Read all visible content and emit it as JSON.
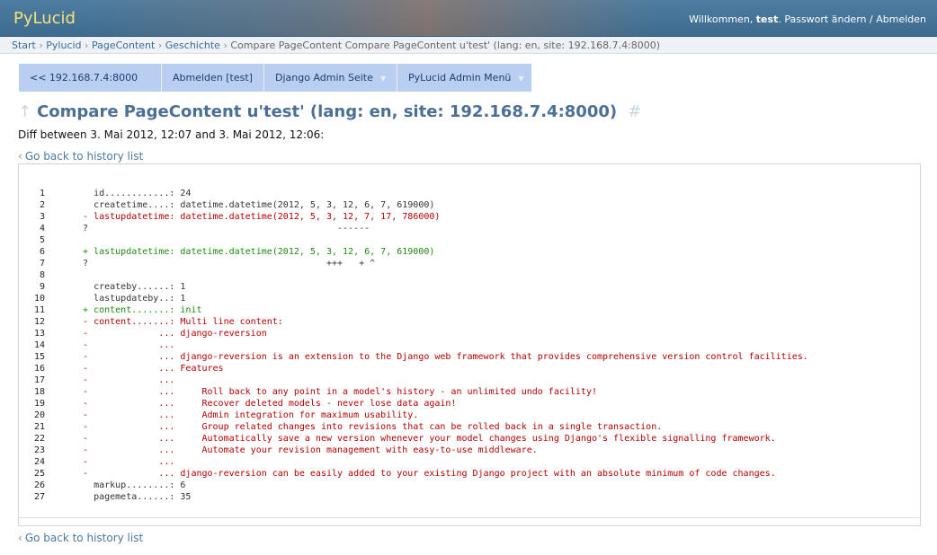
{
  "header": {
    "site_name": "PyLucid",
    "welcome": "Willkommen,",
    "user": "test",
    "change_password": "Passwort ändern",
    "separator": "/",
    "logout": "Abmelden"
  },
  "breadcrumb": {
    "items": [
      "Start",
      "Pylucid",
      "PageContent",
      "Geschichte"
    ],
    "current": "Compare PageContent Compare PageContent u'test' (lang: en, site: 192.168.7.4:8000)"
  },
  "menu": {
    "items": [
      {
        "label": "<< 192.168.7.4:8000",
        "dropdown": false
      },
      {
        "label": "Abmelden [test]",
        "dropdown": false
      },
      {
        "label": "Django Admin Seite",
        "dropdown": true
      },
      {
        "label": "PyLucid Admin Menü",
        "dropdown": true
      }
    ]
  },
  "page": {
    "title_arrow": "↑",
    "title": "Compare PageContent u'test' (lang: en, site: 192.168.7.4:8000)",
    "title_hash": "#",
    "diff_info": "Diff between 3. Mai 2012, 12:07 and 3. Mai 2012, 12:06:",
    "back_chevron": "‹",
    "back_link": "Go back to history list"
  },
  "diff": [
    {
      "n": "1",
      "type": "ctx",
      "text": "    id............: 24"
    },
    {
      "n": "2",
      "type": "ctx",
      "text": "    createtime....: datetime.datetime(2012, 5, 3, 12, 6, 7, 619000)"
    },
    {
      "n": "3",
      "type": "del",
      "text": "  - lastupdatetime: datetime.datetime(2012, 5, 3, 12, 7, 17, 786000)"
    },
    {
      "n": "4",
      "type": "hint",
      "text": "  ?                                              ------"
    },
    {
      "n": "5",
      "type": "ctx",
      "text": ""
    },
    {
      "n": "6",
      "type": "add",
      "text": "  + lastupdatetime: datetime.datetime(2012, 5, 3, 12, 6, 7, 619000)"
    },
    {
      "n": "7",
      "type": "hint",
      "text": "  ?                                            +++   + ^"
    },
    {
      "n": "8",
      "type": "ctx",
      "text": ""
    },
    {
      "n": "9",
      "type": "ctx",
      "text": "    createby......: 1"
    },
    {
      "n": "10",
      "type": "ctx",
      "text": "    lastupdateby..: 1"
    },
    {
      "n": "11",
      "type": "add",
      "text": "  + content.......: init"
    },
    {
      "n": "12",
      "type": "del",
      "text": "  - content.......: Multi line content:"
    },
    {
      "n": "13",
      "type": "del",
      "text": "  -             ... django-reversion"
    },
    {
      "n": "14",
      "type": "del",
      "text": "  -             ..."
    },
    {
      "n": "15",
      "type": "del",
      "text": "  -             ... django-reversion is an extension to the Django web framework that provides comprehensive version control facilities."
    },
    {
      "n": "16",
      "type": "del",
      "text": "  -             ... Features"
    },
    {
      "n": "17",
      "type": "del",
      "text": "  -             ..."
    },
    {
      "n": "18",
      "type": "del",
      "text": "  -             ...     Roll back to any point in a model's history - an unlimited undo facility!"
    },
    {
      "n": "19",
      "type": "del",
      "text": "  -             ...     Recover deleted models - never lose data again!"
    },
    {
      "n": "20",
      "type": "del",
      "text": "  -             ...     Admin integration for maximum usability."
    },
    {
      "n": "21",
      "type": "del",
      "text": "  -             ...     Group related changes into revisions that can be rolled back in a single transaction."
    },
    {
      "n": "22",
      "type": "del",
      "text": "  -             ...     Automatically save a new version whenever your model changes using Django's flexible signalling framework."
    },
    {
      "n": "23",
      "type": "del",
      "text": "  -             ...     Automate your revision management with easy-to-use middleware."
    },
    {
      "n": "24",
      "type": "del",
      "text": "  -             ..."
    },
    {
      "n": "25",
      "type": "del",
      "text": "  -             ... django-reversion can be easily added to your existing Django project with an absolute minimum of code changes."
    },
    {
      "n": "26",
      "type": "ctx",
      "text": "    markup........: 6"
    },
    {
      "n": "27",
      "type": "ctx",
      "text": "    pagemeta......: 35"
    }
  ]
}
